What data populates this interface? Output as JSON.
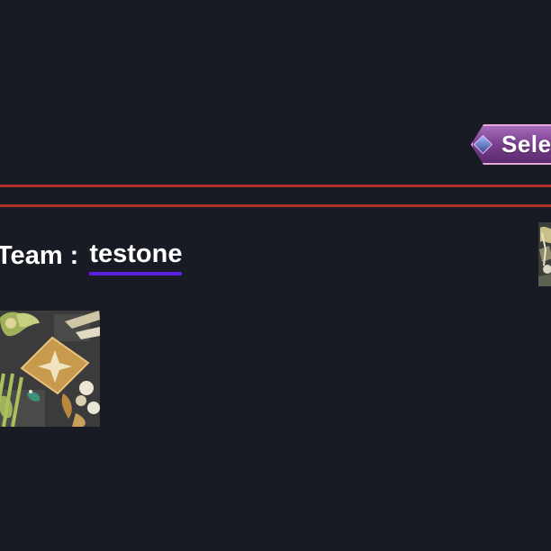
{
  "header": {
    "select_button_label": "Selec"
  },
  "team": {
    "label": "Team :",
    "name": "testone"
  },
  "colors": {
    "background": "#181a24",
    "divider": "#b0302a",
    "underline": "#5a1fe0",
    "button": "#7a3f8e"
  }
}
